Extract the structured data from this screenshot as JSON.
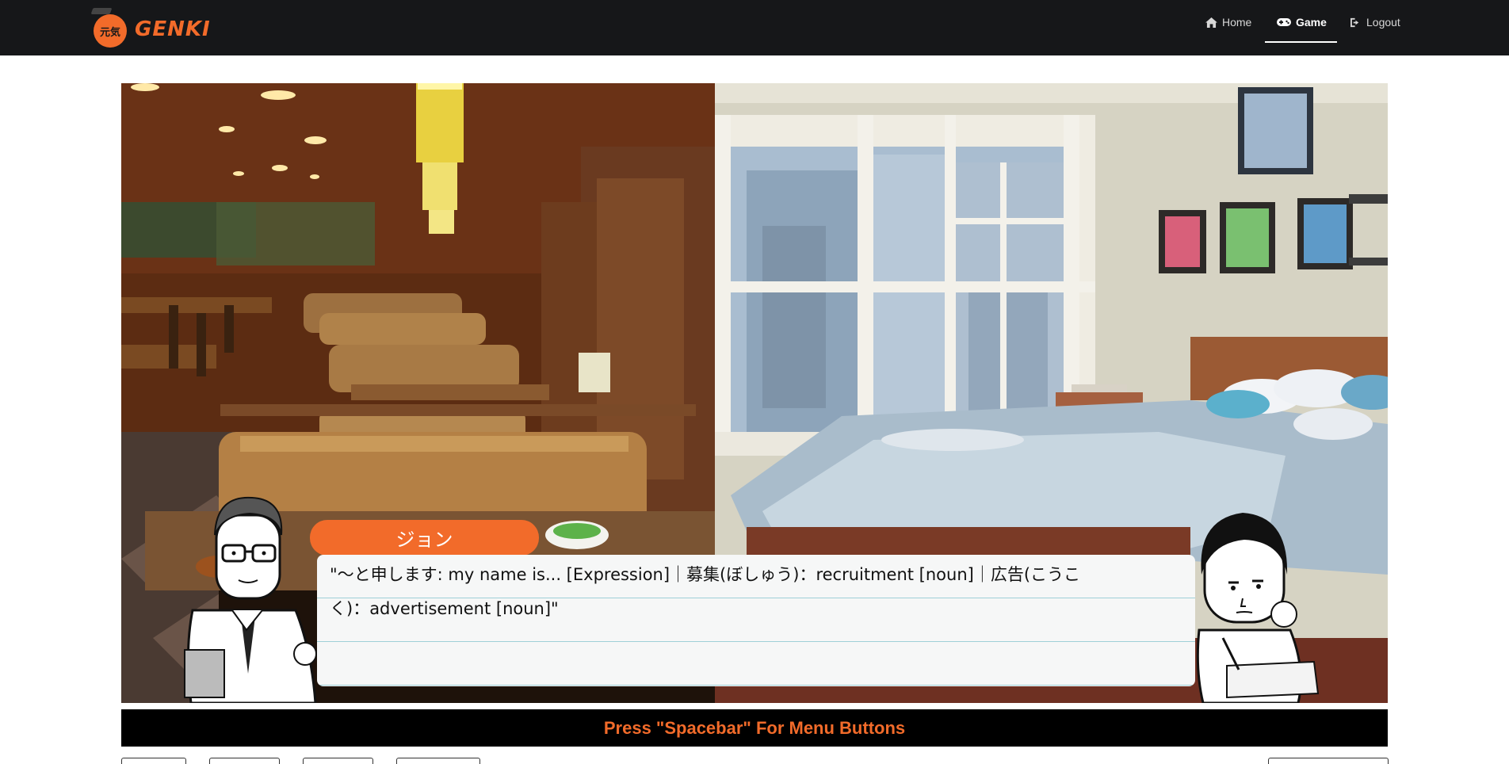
{
  "navbar": {
    "logo_text": "GENKI",
    "logo_kanji": "元気",
    "items": [
      {
        "label": "Home",
        "icon": "home-icon"
      },
      {
        "label": "Game",
        "icon": "gamepad-icon",
        "active": true
      },
      {
        "label": "Logout",
        "icon": "logout-icon"
      }
    ]
  },
  "dialog": {
    "speaker": "ジョン",
    "text": "\"～と申します: my name is... [Expression]｜募集(ぼしゅう)：recruitment [noun]｜広告(こうこく)：advertisement [noun]\""
  },
  "menu": {
    "hint": "Press \"Spacebar\" For Menu Buttons"
  },
  "colors": {
    "accent": "#f26b2a",
    "navbar_bg": "#161719",
    "dialog_line": "#9fd0d8"
  }
}
